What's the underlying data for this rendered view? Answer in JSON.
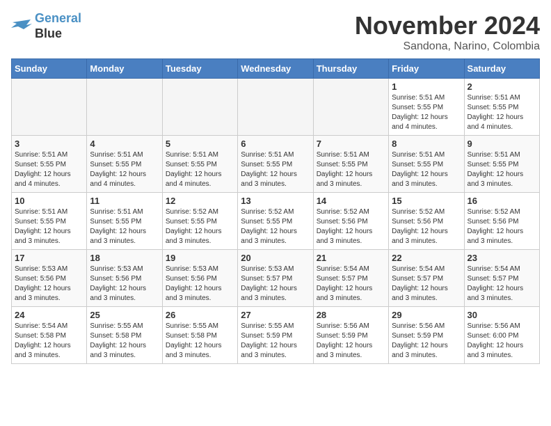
{
  "logo": {
    "line1": "General",
    "line2": "Blue"
  },
  "title": "November 2024",
  "location": "Sandona, Narino, Colombia",
  "weekdays": [
    "Sunday",
    "Monday",
    "Tuesday",
    "Wednesday",
    "Thursday",
    "Friday",
    "Saturday"
  ],
  "weeks": [
    [
      {
        "day": "",
        "info": ""
      },
      {
        "day": "",
        "info": ""
      },
      {
        "day": "",
        "info": ""
      },
      {
        "day": "",
        "info": ""
      },
      {
        "day": "",
        "info": ""
      },
      {
        "day": "1",
        "info": "Sunrise: 5:51 AM\nSunset: 5:55 PM\nDaylight: 12 hours\nand 4 minutes."
      },
      {
        "day": "2",
        "info": "Sunrise: 5:51 AM\nSunset: 5:55 PM\nDaylight: 12 hours\nand 4 minutes."
      }
    ],
    [
      {
        "day": "3",
        "info": "Sunrise: 5:51 AM\nSunset: 5:55 PM\nDaylight: 12 hours\nand 4 minutes."
      },
      {
        "day": "4",
        "info": "Sunrise: 5:51 AM\nSunset: 5:55 PM\nDaylight: 12 hours\nand 4 minutes."
      },
      {
        "day": "5",
        "info": "Sunrise: 5:51 AM\nSunset: 5:55 PM\nDaylight: 12 hours\nand 4 minutes."
      },
      {
        "day": "6",
        "info": "Sunrise: 5:51 AM\nSunset: 5:55 PM\nDaylight: 12 hours\nand 3 minutes."
      },
      {
        "day": "7",
        "info": "Sunrise: 5:51 AM\nSunset: 5:55 PM\nDaylight: 12 hours\nand 3 minutes."
      },
      {
        "day": "8",
        "info": "Sunrise: 5:51 AM\nSunset: 5:55 PM\nDaylight: 12 hours\nand 3 minutes."
      },
      {
        "day": "9",
        "info": "Sunrise: 5:51 AM\nSunset: 5:55 PM\nDaylight: 12 hours\nand 3 minutes."
      }
    ],
    [
      {
        "day": "10",
        "info": "Sunrise: 5:51 AM\nSunset: 5:55 PM\nDaylight: 12 hours\nand 3 minutes."
      },
      {
        "day": "11",
        "info": "Sunrise: 5:51 AM\nSunset: 5:55 PM\nDaylight: 12 hours\nand 3 minutes."
      },
      {
        "day": "12",
        "info": "Sunrise: 5:52 AM\nSunset: 5:55 PM\nDaylight: 12 hours\nand 3 minutes."
      },
      {
        "day": "13",
        "info": "Sunrise: 5:52 AM\nSunset: 5:55 PM\nDaylight: 12 hours\nand 3 minutes."
      },
      {
        "day": "14",
        "info": "Sunrise: 5:52 AM\nSunset: 5:56 PM\nDaylight: 12 hours\nand 3 minutes."
      },
      {
        "day": "15",
        "info": "Sunrise: 5:52 AM\nSunset: 5:56 PM\nDaylight: 12 hours\nand 3 minutes."
      },
      {
        "day": "16",
        "info": "Sunrise: 5:52 AM\nSunset: 5:56 PM\nDaylight: 12 hours\nand 3 minutes."
      }
    ],
    [
      {
        "day": "17",
        "info": "Sunrise: 5:53 AM\nSunset: 5:56 PM\nDaylight: 12 hours\nand 3 minutes."
      },
      {
        "day": "18",
        "info": "Sunrise: 5:53 AM\nSunset: 5:56 PM\nDaylight: 12 hours\nand 3 minutes."
      },
      {
        "day": "19",
        "info": "Sunrise: 5:53 AM\nSunset: 5:56 PM\nDaylight: 12 hours\nand 3 minutes."
      },
      {
        "day": "20",
        "info": "Sunrise: 5:53 AM\nSunset: 5:57 PM\nDaylight: 12 hours\nand 3 minutes."
      },
      {
        "day": "21",
        "info": "Sunrise: 5:54 AM\nSunset: 5:57 PM\nDaylight: 12 hours\nand 3 minutes."
      },
      {
        "day": "22",
        "info": "Sunrise: 5:54 AM\nSunset: 5:57 PM\nDaylight: 12 hours\nand 3 minutes."
      },
      {
        "day": "23",
        "info": "Sunrise: 5:54 AM\nSunset: 5:57 PM\nDaylight: 12 hours\nand 3 minutes."
      }
    ],
    [
      {
        "day": "24",
        "info": "Sunrise: 5:54 AM\nSunset: 5:58 PM\nDaylight: 12 hours\nand 3 minutes."
      },
      {
        "day": "25",
        "info": "Sunrise: 5:55 AM\nSunset: 5:58 PM\nDaylight: 12 hours\nand 3 minutes."
      },
      {
        "day": "26",
        "info": "Sunrise: 5:55 AM\nSunset: 5:58 PM\nDaylight: 12 hours\nand 3 minutes."
      },
      {
        "day": "27",
        "info": "Sunrise: 5:55 AM\nSunset: 5:59 PM\nDaylight: 12 hours\nand 3 minutes."
      },
      {
        "day": "28",
        "info": "Sunrise: 5:56 AM\nSunset: 5:59 PM\nDaylight: 12 hours\nand 3 minutes."
      },
      {
        "day": "29",
        "info": "Sunrise: 5:56 AM\nSunset: 5:59 PM\nDaylight: 12 hours\nand 3 minutes."
      },
      {
        "day": "30",
        "info": "Sunrise: 5:56 AM\nSunset: 6:00 PM\nDaylight: 12 hours\nand 3 minutes."
      }
    ]
  ]
}
